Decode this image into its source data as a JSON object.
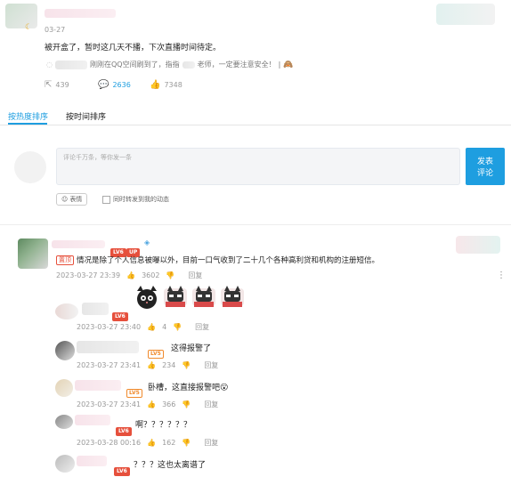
{
  "post": {
    "date": "03-27",
    "text": "被开盒了，暂时这几天不播，下次直播时间待定。",
    "quote_prefix": "刚刚在QQ空间刷到了，指指",
    "quote_mid": "老师，一定要注意安全！",
    "quote_suffix": "|",
    "repost_count": "439",
    "comment_count": "2636",
    "like_count": "7348"
  },
  "tabs": {
    "hot": "按热度排序",
    "time": "按时间排序"
  },
  "composer": {
    "placeholder": "评论千万条，等你发一条",
    "submit_line1": "发表",
    "submit_line2": "评论",
    "emoji_label": "表情",
    "repost_label": "同时转发到我的动态"
  },
  "comments": [
    {
      "level": "LV6",
      "badge": "UP",
      "tag": "置顶",
      "text": "情况是除了个人信息被曝以外，目前一口气收到了二十几个各种高利贷和机构的注册短信。",
      "time": "2023-03-27 23:39",
      "likes": "3602",
      "reply": "回复"
    }
  ],
  "replies": [
    {
      "level": "LV6",
      "text": "",
      "time": "2023-03-27 23:40",
      "likes": "4",
      "reply": "回复"
    },
    {
      "level": "LV5",
      "text": "这得报警了",
      "time": "2023-03-27 23:41",
      "likes": "234",
      "reply": "回复"
    },
    {
      "level": "LV5",
      "text": "卧槽，这直接报警吧😮",
      "time": "2023-03-27 23:41",
      "likes": "366",
      "reply": "回复"
    },
    {
      "level": "LV6",
      "text": "啊？？？？？？",
      "time": "2023-03-28 00:16",
      "likes": "162",
      "reply": "回复"
    },
    {
      "level": "LV6",
      "text": "？？？这也太离谱了",
      "time": "",
      "likes": "",
      "reply": ""
    }
  ],
  "colors": {
    "accent": "#1e9ee0",
    "level_red": "#e6503c",
    "level_orange": "#f08a2c"
  }
}
